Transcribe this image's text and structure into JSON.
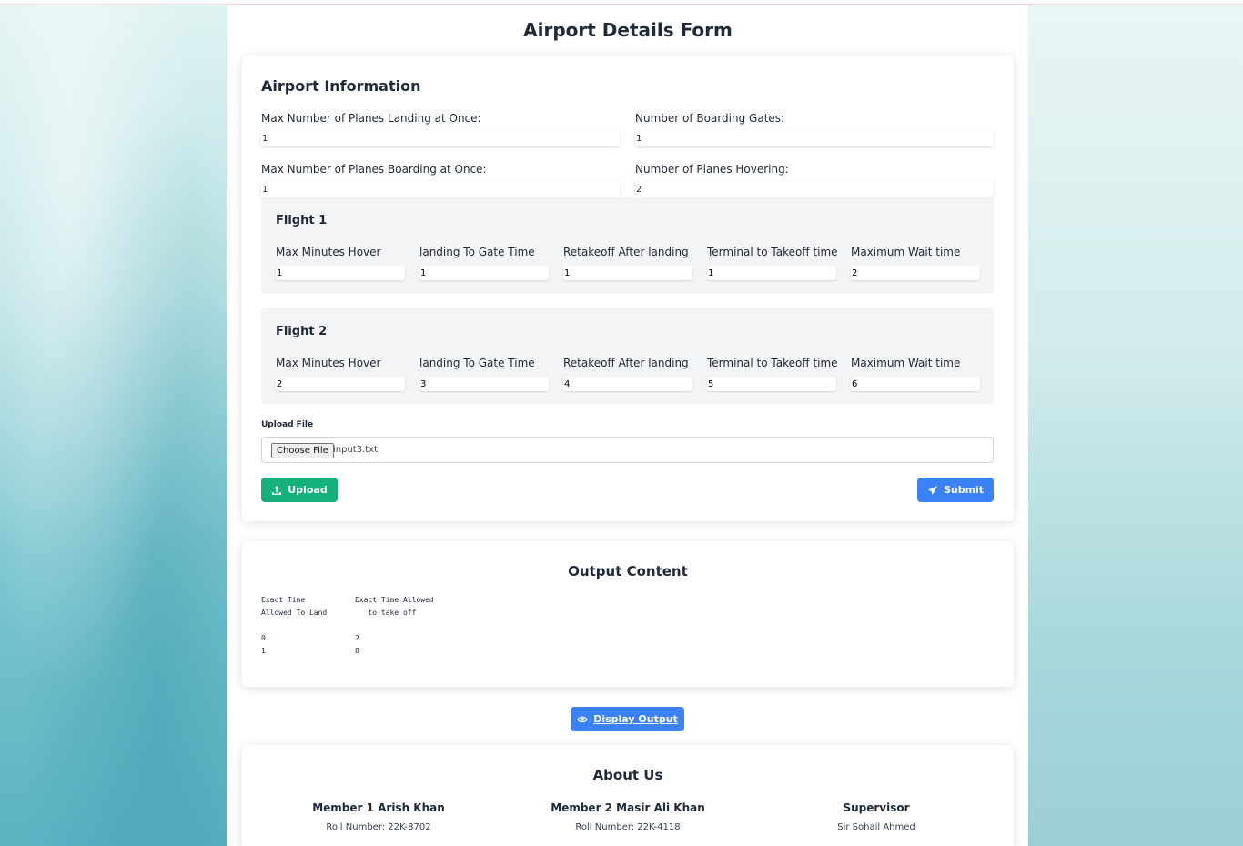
{
  "page_title": "Airport Details Form",
  "airport": {
    "section_title": "Airport Information",
    "fields": {
      "max_landing": {
        "label": "Max Number of Planes Landing at Once:",
        "value": "1"
      },
      "boarding_gates": {
        "label": "Number of Boarding Gates:",
        "value": "1"
      },
      "max_boarding": {
        "label": "Max Number of Planes Boarding at Once:",
        "value": "1"
      },
      "hovering": {
        "label": "Number of Planes Hovering:",
        "value": "2"
      }
    }
  },
  "flight_columns": [
    "Max Minutes Hover",
    "landing To Gate Time",
    "Retakeoff After landing",
    "Terminal to Takeoff time",
    "Maximum Wait time"
  ],
  "flights": [
    {
      "title": "Flight 1",
      "values": [
        "1",
        "1",
        "1",
        "1",
        "2"
      ]
    },
    {
      "title": "Flight 2",
      "values": [
        "2",
        "3",
        "4",
        "5",
        "6"
      ]
    }
  ],
  "upload": {
    "label": "Upload File",
    "choose_button": "Choose File",
    "file_name": "input3.txt",
    "upload_button": "Upload",
    "submit_button": "Submit"
  },
  "output": {
    "title": "Output Content",
    "col1_header_line1": "Exact Time",
    "col1_header_line2": "Allowed To Land",
    "col2_header_line1": "Exact Time Allowed",
    "col2_header_line2": "   to take off",
    "rows": [
      {
        "land": "0",
        "takeoff": "2"
      },
      {
        "land": "1",
        "takeoff": "8"
      }
    ],
    "display_button": "Display Output"
  },
  "about": {
    "title": "About Us",
    "members": [
      {
        "name": "Member 1 Arish Khan",
        "detail": "Roll Number: 22K-8702"
      },
      {
        "name": "Member 2 Masir Ali Khan",
        "detail": "Roll Number: 22K-4118"
      },
      {
        "name": "Supervisor",
        "detail": "Sir Sohail Ahmed"
      }
    ]
  },
  "colors": {
    "upload_green": "#16b07a",
    "primary_blue": "#3b82f6"
  }
}
